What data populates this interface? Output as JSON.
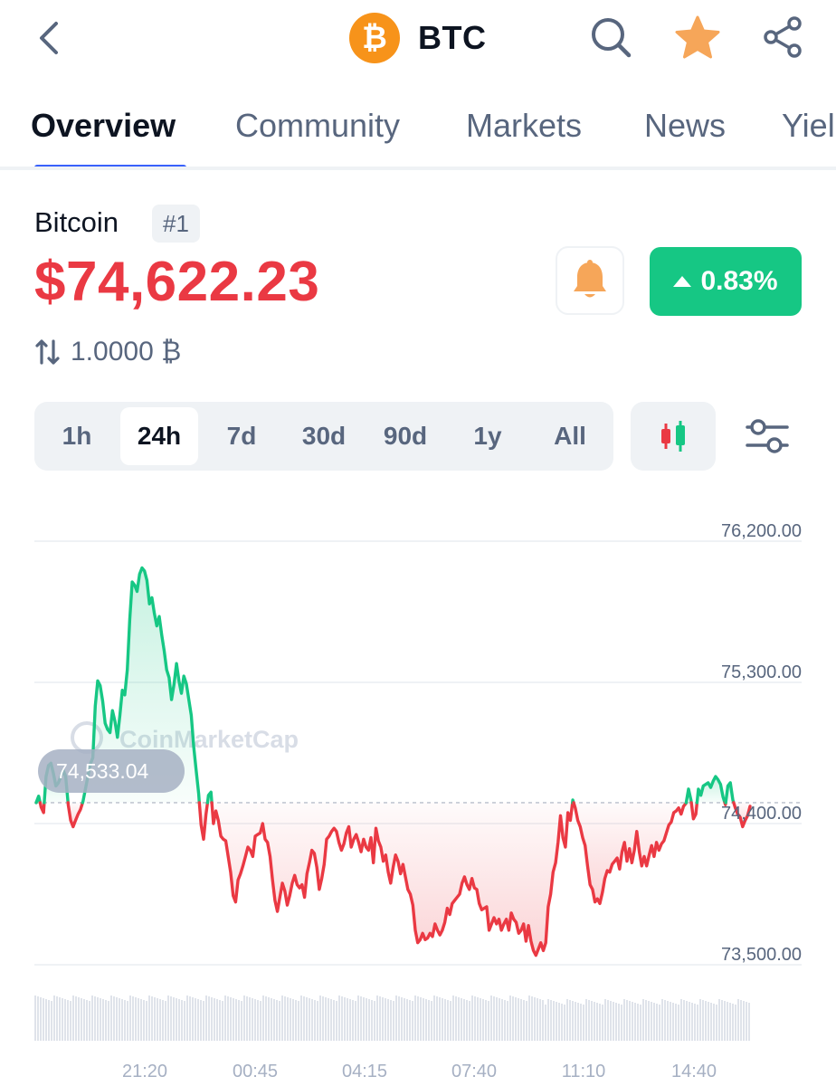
{
  "header": {
    "symbol": "BTC",
    "coin_glyph": "₿"
  },
  "tabs": [
    {
      "label": "Overview",
      "active": true
    },
    {
      "label": "Community",
      "active": false
    },
    {
      "label": "Markets",
      "active": false
    },
    {
      "label": "News",
      "active": false
    },
    {
      "label": "Yiel",
      "active": false
    }
  ],
  "coin": {
    "name": "Bitcoin",
    "rank": "#1",
    "price": "$74,622.23",
    "change_pct": "0.83%",
    "btc_rate": "1.0000 ₿"
  },
  "periods": [
    {
      "label": "1h",
      "active": false
    },
    {
      "label": "24h",
      "active": true
    },
    {
      "label": "7d",
      "active": false
    },
    {
      "label": "30d",
      "active": false
    },
    {
      "label": "90d",
      "active": false
    },
    {
      "label": "1y",
      "active": false
    },
    {
      "label": "All",
      "active": false
    }
  ],
  "colors": {
    "up": "#16c784",
    "down": "#ea3943",
    "accent": "#3861fb",
    "coin": "#f7931a",
    "star": "#f6a659"
  },
  "chart_data": {
    "type": "line",
    "watermark": "CoinMarketCap",
    "reference_value": 74533.04,
    "reference_label": "74,533.04",
    "yticks": [
      "76,200.00",
      "75,300.00",
      "74,400.00",
      "73,500.00"
    ],
    "ylim": [
      73500,
      76200
    ],
    "xticks": [
      "21:20",
      "00:45",
      "04:15",
      "07:40",
      "11:10",
      "14:40"
    ],
    "series": [
      {
        "values": [
          74533,
          74575,
          74505,
          74470,
          74700,
          74770,
          74785,
          74720,
          74640,
          74660,
          74700,
          74740,
          74700,
          74520,
          74420,
          74380,
          74420,
          74460,
          74490,
          74540,
          74620,
          74700,
          74780,
          74820,
          75150,
          75310,
          75280,
          75180,
          75040,
          75000,
          74980,
          75120,
          75050,
          74950,
          75090,
          75250,
          75220,
          75380,
          75700,
          75940,
          75920,
          75880,
          75990,
          76030,
          76010,
          75950,
          75800,
          75840,
          75740,
          75660,
          75720,
          75600,
          75500,
          75380,
          75330,
          75190,
          75290,
          75420,
          75310,
          75230,
          75340,
          75290,
          75190,
          75090,
          74890,
          74740,
          74590,
          74390,
          74300,
          74460,
          74580,
          74600,
          74400,
          74480,
          74420,
          74320,
          74300,
          74290,
          74190,
          74090,
          73940,
          73900,
          74040,
          74080,
          74130,
          74190,
          74250,
          74230,
          74190,
          74320,
          74330,
          74340,
          74400,
          74300,
          74280,
          74190,
          74040,
          73910,
          73840,
          73930,
          74020,
          73970,
          73880,
          73940,
          74020,
          74070,
          74010,
          73990,
          74010,
          73930,
          74080,
          74150,
          74230,
          74210,
          74120,
          73980,
          74050,
          74140,
          74300,
          74320,
          74350,
          74370,
          74350,
          74280,
          74230,
          74270,
          74340,
          74380,
          74250,
          74300,
          74330,
          74280,
          74220,
          74300,
          74250,
          74230,
          74310,
          74150,
          74370,
          74290,
          74250,
          74160,
          74200,
          74090,
          74020,
          74120,
          74200,
          74160,
          74080,
          74140,
          74060,
          73980,
          73950,
          73880,
          73720,
          73640,
          73660,
          73700,
          73660,
          73670,
          73700,
          73680,
          73760,
          73720,
          73690,
          73720,
          73770,
          73860,
          73820,
          73890,
          73910,
          73930,
          73950,
          74020,
          74060,
          74010,
          73980,
          74050,
          73990,
          73980,
          73890,
          73850,
          73860,
          73870,
          73720,
          73760,
          73800,
          73760,
          73790,
          73720,
          73760,
          73790,
          73720,
          73830,
          73790,
          73770,
          73700,
          73720,
          73760,
          73650,
          73750,
          73650,
          73590,
          73560,
          73600,
          73640,
          73590,
          73640,
          73870,
          73950,
          74090,
          74150,
          74280,
          74450,
          74310,
          74250,
          74470,
          74420,
          74550,
          74500,
          74420,
          74380,
          74310,
          74260,
          74130,
          74010,
          73980,
          73900,
          73920,
          73890,
          73960,
          74050,
          74100,
          74090,
          74140,
          74160,
          74180,
          74110,
          74220,
          74280,
          74160,
          74240,
          74150,
          74230,
          74350,
          74220,
          74130,
          74190,
          74130,
          74200,
          74260,
          74190,
          74280,
          74230,
          74270,
          74290,
          74340,
          74390,
          74410,
          74470,
          74480,
          74500,
          74460,
          74510,
          74530,
          74620,
          74550,
          74430,
          74460,
          74620,
          74580,
          74640,
          74650,
          74660,
          74630,
          74670,
          74700,
          74680,
          74650,
          74570,
          74520,
          74640,
          74660,
          74550,
          74500,
          74460,
          74440,
          74380,
          74420,
          74450,
          74510
        ]
      }
    ],
    "volume_note": "volume bars (unlabeled)",
    "grid": true
  }
}
